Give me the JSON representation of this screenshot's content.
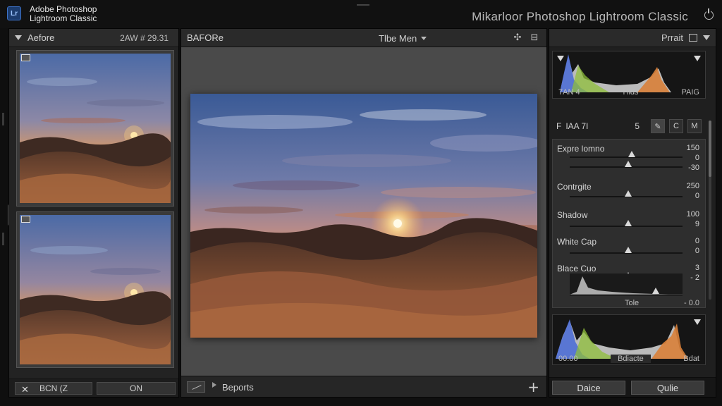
{
  "app": {
    "name_line1": "Adobe Photoshop",
    "name_line2": "Lightroom Classic",
    "logo_text": "Lr",
    "module_title": "Mikarloor Photoshop Lightroom Classic"
  },
  "left_panel": {
    "header_label": "Aefore",
    "header_meta": "2AW # 29.31",
    "footer_btn_1": "BCN (Z",
    "footer_btn_2": "ON"
  },
  "center_panel": {
    "before_label": "BAFORe",
    "view_select": "Tlbe Men",
    "export_label": "Beports",
    "add_icon": "+"
  },
  "right_panel": {
    "header_label": "Prrait",
    "histogram_top": {
      "left": "7AN 4",
      "center": "Hlds",
      "right": "PAIG"
    },
    "tools": {
      "letter_f": "F",
      "label": "IAA 7I",
      "letter_s": "5",
      "btn_c": "C",
      "btn_m": "M"
    },
    "sliders": [
      {
        "label": "Expre lomno",
        "value": "150",
        "value2": "0",
        "value3": "-30",
        "pos": 0.55,
        "pos2": 0.52
      },
      {
        "label": "Contrgite",
        "value": "250",
        "value2": "0",
        "pos": 0.52
      },
      {
        "label": "Shadow",
        "value": "100",
        "value2": "9",
        "pos": 0.52
      },
      {
        "label": "White Cap",
        "value": "0",
        "value2": "0",
        "pos": 0.52
      },
      {
        "label": "Blace Cuo",
        "value": "3",
        "value2": "- 2",
        "pos": 0.52,
        "pos2": 0.76
      }
    ],
    "tone_label": "Tole",
    "tone_value": "- 0.0",
    "histogram_bottom": {
      "left": "00.00",
      "center": "Bdiacte",
      "right": "Bdat"
    },
    "footer_btn_1": "Daice",
    "footer_btn_2": "Qulie"
  },
  "colors": {
    "histogram_blue": "#4f6fd6",
    "histogram_green": "#8fbf3a",
    "histogram_orange": "#d9813a",
    "histogram_white": "#d8d8d8"
  }
}
